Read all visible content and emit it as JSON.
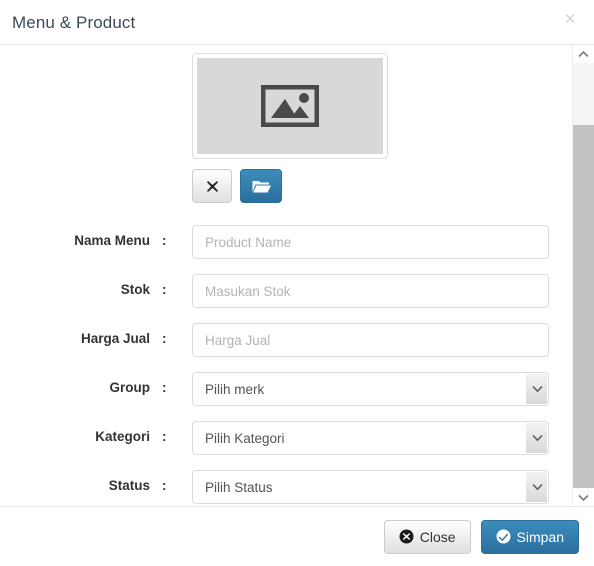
{
  "modal": {
    "title": "Menu & Product",
    "close_icon": "close-x-icon",
    "close_label": "×"
  },
  "image_upload": {
    "placeholder_icon": "picture-placeholder-icon",
    "remove_button": {
      "icon": "x-icon",
      "label": ""
    },
    "browse_button": {
      "icon": "open-folder-icon",
      "label": ""
    }
  },
  "form": {
    "fields": [
      {
        "label": "Nama Menu",
        "separator": ":",
        "type": "text",
        "placeholder": "Product Name",
        "value": ""
      },
      {
        "label": "Stok",
        "separator": ":",
        "type": "text",
        "placeholder": "Masukan Stok",
        "value": ""
      },
      {
        "label": "Harga Jual",
        "separator": ":",
        "type": "text",
        "placeholder": "Harga Jual",
        "value": ""
      },
      {
        "label": "Group",
        "separator": ":",
        "type": "select",
        "selected": "Pilih merk",
        "options": [
          "Pilih merk"
        ]
      },
      {
        "label": "Kategori",
        "separator": ":",
        "type": "select",
        "selected": "Pilih Kategori",
        "options": [
          "Pilih Kategori"
        ]
      },
      {
        "label": "Status",
        "separator": ":",
        "type": "select",
        "selected": "Pilih Status",
        "options": [
          "Pilih Status"
        ]
      }
    ]
  },
  "scrollbar": {
    "up_arrow": "▲",
    "down_arrow": "▼"
  },
  "footer": {
    "close_button": {
      "label": "Close",
      "icon": "times-circle-icon"
    },
    "save_button": {
      "label": "Simpan",
      "icon": "check-circle-icon"
    }
  },
  "colors": {
    "primary": "#3c8dbc",
    "primary_dark": "#2a6f9e",
    "title": "#3c4a5a",
    "border": "#dcdcdc",
    "placeholder_bg": "#d8d8d8",
    "scroll_thumb": "#c2c2c2"
  }
}
